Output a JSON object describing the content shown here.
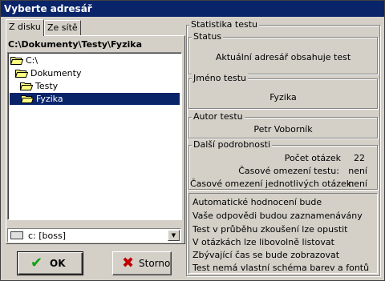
{
  "window": {
    "title": "Vyberte adresář"
  },
  "tabs": [
    {
      "label": "Z disku",
      "active": true
    },
    {
      "label": "Ze sítě",
      "active": false
    }
  ],
  "path": "C:\\Dokumenty\\Testy\\Fyzika",
  "tree": [
    {
      "label": "C:\\",
      "selected": false
    },
    {
      "label": "Dokumenty",
      "selected": false
    },
    {
      "label": "Testy",
      "selected": false
    },
    {
      "label": "Fyzika",
      "selected": true
    }
  ],
  "drive_combo": {
    "value": "c: [boss]"
  },
  "buttons": {
    "ok": "OK",
    "cancel": "Storno"
  },
  "stats": {
    "title": "Statistika testu",
    "status": {
      "label": "Status",
      "text": "Aktuální adresář obsahuje test"
    },
    "name": {
      "label": "Jméno testu",
      "text": "Fyzika"
    },
    "author": {
      "label": "Autor testu",
      "text": "Petr Voborník"
    },
    "details": {
      "label": "Další podrobnosti",
      "rows": [
        {
          "label": "Počet otázek",
          "value": "22"
        },
        {
          "label": "Časové omezení testu:",
          "value": "není"
        },
        {
          "label": "Časové omezení jednotlivých otázek:",
          "value": "není"
        }
      ]
    },
    "features": [
      "Automatické hodnocení bude",
      "Vaše odpovědi budou zaznamenávány",
      "Test v průběhu zkoušení lze opustit",
      "V otázkách lze libovolně listovat",
      "Zbývající čas se bude zobrazovat",
      "Test nemá vlastní schéma barev a fontů"
    ]
  },
  "colors": {
    "titlebar": "#0a246a",
    "selection": "#0a246a",
    "face": "#d4d0c8",
    "folder": "#ffff80",
    "ok_check": "#10a010",
    "cancel_x": "#c00000"
  }
}
